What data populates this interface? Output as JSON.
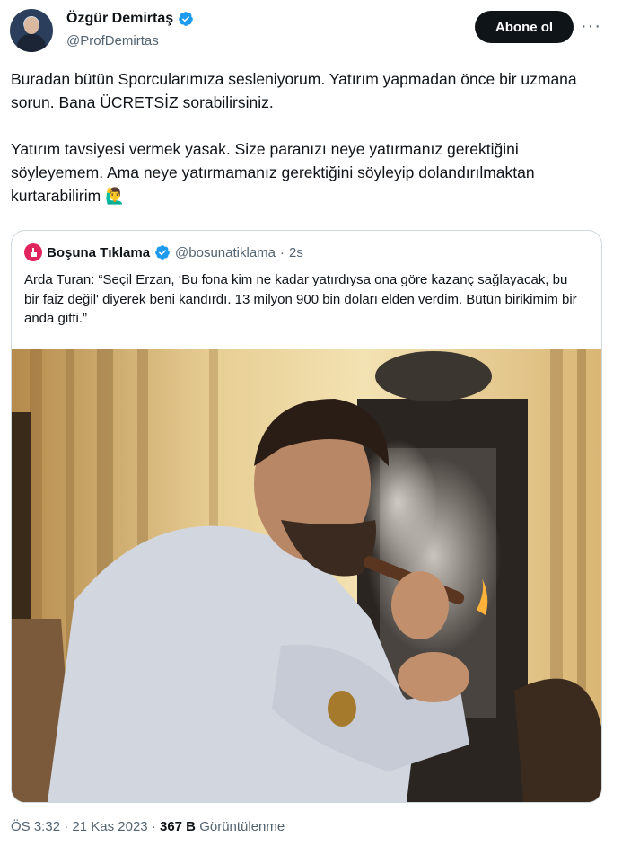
{
  "author": {
    "name": "Özgür Demirtaş",
    "handle": "@ProfDemirtas",
    "verified": true
  },
  "actions": {
    "follow_label": "Abone ol",
    "more_label": "···"
  },
  "tweet": {
    "paragraph1": "Buradan bütün Sporcularımıza sesleniyorum. Yatırım yapmadan önce bir uzmana sorun. Bana ÜCRETSİZ sorabilirsiniz.",
    "paragraph2": "Yatırım tavsiyesi vermek yasak. Size paranızı neye yatırmanız gerektiğini söyleyemem. Ama neye yatırmamanız gerektiğini söyleyip dolandırılmaktan kurtarabilirim",
    "emoji": "🙋‍♂️"
  },
  "quoted": {
    "name": "Boşuna Tıklama",
    "handle": "@bosunatiklama",
    "separator": "·",
    "time": "2s",
    "text": "Arda Turan: “Seçil Erzan, ‘Bu fona kim ne kadar yatırdıysa ona göre kazanç sağlayacak, bu bir faiz değil' diyerek beni kandırdı. 13 milyon 900 bin doları elden verdim. Bütün birikimim bir anda gitti.”"
  },
  "meta": {
    "time": "ÖS 3:32",
    "separator": "·",
    "date": "21 Kas 2023",
    "views_count": "367 B",
    "views_label": "Görüntülenme"
  },
  "colors": {
    "verified_blue": "#1d9bf0",
    "follow_bg": "#0f1419",
    "muted_text": "#536471",
    "border": "#cfd9de"
  }
}
